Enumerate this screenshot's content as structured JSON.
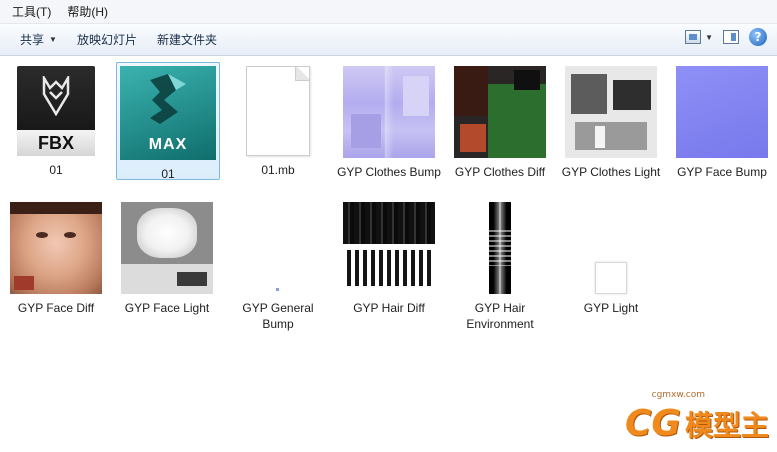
{
  "menubar": {
    "items": [
      "工具(T)",
      "帮助(H)"
    ]
  },
  "toolbar": {
    "share_label": "共享",
    "slideshow_label": "放映幻灯片",
    "new_folder_label": "新建文件夹"
  },
  "files": [
    {
      "name": "01",
      "icon": "fbx-file-icon",
      "badge": "FBX"
    },
    {
      "name": "01",
      "icon": "3ds-max-file-icon",
      "badge": "MAX",
      "selected": true
    },
    {
      "name": "01.mb",
      "icon": "generic-document-icon"
    },
    {
      "name": "GYP Clothes Bump",
      "icon": "clothes-bump-texture"
    },
    {
      "name": "GYP Clothes Diff",
      "icon": "clothes-diffuse-texture"
    },
    {
      "name": "GYP Clothes Light",
      "icon": "clothes-light-texture"
    },
    {
      "name": "GYP Face Bump",
      "icon": "face-bump-texture"
    },
    {
      "name": "GYP Face Diff",
      "icon": "face-diffuse-texture"
    },
    {
      "name": "GYP Face Light",
      "icon": "face-light-texture"
    },
    {
      "name": "GYP General Bump",
      "icon": "general-bump-texture"
    },
    {
      "name": "GYP Hair Diff",
      "icon": "hair-diffuse-texture"
    },
    {
      "name": "GYP Hair Environment",
      "icon": "hair-environment-texture"
    },
    {
      "name": "GYP Light",
      "icon": "light-texture"
    }
  ],
  "watermark": {
    "logo": "CG",
    "text": "模型主",
    "url": "cgmxw.com"
  },
  "colors": {
    "selection_border": "#7fb8e0",
    "watermark_orange": "#f08a1c"
  }
}
